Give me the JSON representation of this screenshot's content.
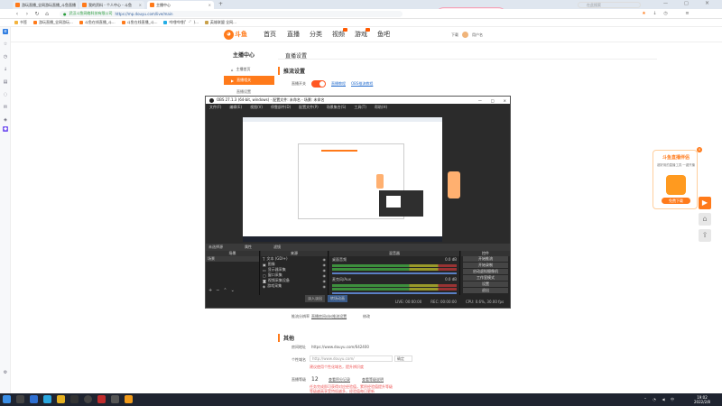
{
  "browser": {
    "tabs": [
      {
        "title": "游玩直播_全网游玩直播_斗鱼直播",
        "active": false,
        "color": "#ff7a1a"
      },
      {
        "title": "我的资料 - 个人中心 - 斗鱼",
        "active": false,
        "color": "#ff7a1a"
      },
      {
        "title": "主播中心",
        "active": true,
        "color": "#ff7a1a"
      }
    ],
    "address": {
      "secure_label": "武汉斗鱼网络科技有限公司",
      "url": "https://mp.douyu.com/live/main"
    },
    "search_placeholder": "在此搜索",
    "bookmarks": [
      "书签",
      "游玩直播_全网游玩...",
      "斗鱼在线直播_斗...",
      "斗鱼在线直播_斗...",
      "哔哩哔哩(゜-゜)...",
      "英雄联盟 全网..."
    ]
  },
  "pink_button": "国标",
  "douyu": {
    "logo": "斗鱼",
    "nav": [
      "首页",
      "直播",
      "分类",
      "视频",
      "游戏",
      "鱼吧"
    ],
    "user_label": "下载",
    "user_name": "用户名"
  },
  "center": {
    "title": "主播中心",
    "menu": [
      "主播首页",
      "直播相关",
      "直播设置"
    ],
    "page_heading": "直播设置",
    "section": "推流设置",
    "toggle_label": "直播开关",
    "link1": "直播教程",
    "link2": "OBS推流教程"
  },
  "lower": {
    "bind_label": "推流分辨率",
    "bind_link": "直播房间obs推流设置",
    "bind_extra": "修改",
    "other_title": "其他",
    "room_label": "房间地址",
    "room_url": "https://www.douyu.com/642400",
    "nick_label": "个性域名",
    "nick_placeholder": "http://www.douyu.com/",
    "nick_btn": "确定",
    "nick_hint": "建议使用个性化域名，提升辨识度",
    "level_label": "直播等级",
    "level_value": "12",
    "level_link1": "查看积分记录",
    "level_link2": "查看等级说明",
    "level_note1": "任务完成即可获得对应经验值，累积经验值提升等级",
    "level_note2": "等级越高享受特权越多，经验值每日更新"
  },
  "promo": {
    "title": "斗鱼直播伴侣",
    "desc": "超好用的直播工具 一键开播",
    "button": "免费下载"
  },
  "obs": {
    "title": "OBS 27.1.3 (64-bit, windows) - 配置文件: 未命名 - 场景: 未命名",
    "menu": [
      "文件(F)",
      "编辑(E)",
      "视图(V)",
      "停靠部件(D)",
      "配置文件(P)",
      "场景集合(S)",
      "工具(T)",
      "帮助(H)"
    ],
    "midbar": [
      "未选择源",
      "属性",
      "滤镜"
    ],
    "docks": [
      "场景",
      "来源",
      "混音器",
      "转场动画",
      "控件"
    ],
    "scenes": [
      "场景"
    ],
    "sources": [
      "文本 (GDI+)",
      "图像",
      "显示器采集",
      "窗口采集",
      "视频采集设备",
      "游戏采集",
      "媒体源"
    ],
    "mixer": [
      {
        "name": "桌面音频",
        "db": "0.0 dB"
      },
      {
        "name": "麦克风/Aux",
        "db": "0.0 dB"
      }
    ],
    "transition": {
      "name": "淡入淡出",
      "duration_label": "时长",
      "duration": "300 ms"
    },
    "controls": [
      "开始推流",
      "开始录制",
      "启动虚拟摄像机",
      "工作室模式",
      "设置",
      "退出"
    ],
    "status": [
      "LIVE: 00:00:00",
      "REC: 00:00:00",
      "CPU: 0.6%, 30.00 fps"
    ]
  },
  "taskbar": {
    "time": "19:02",
    "date": "2022/2/8"
  }
}
